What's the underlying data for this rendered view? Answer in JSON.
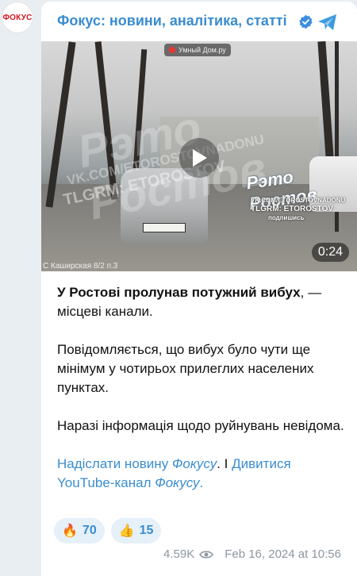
{
  "avatar": {
    "label": "ФОКУС"
  },
  "header": {
    "channel_name": "Фокус: новини, аналітика, статті",
    "verified_icon": "verified-badge-icon",
    "telegram_icon": "telegram-plane-icon"
  },
  "video": {
    "camera_tag": "Умный Дом.ру",
    "watermark_title": "Рэто Ростов",
    "watermark_vk": "VK.COM/ETOROSTOVNADONU",
    "watermark_tlgrm": "TLGRM: ETOROSTOV",
    "logo_title": "Рэто Ростов",
    "logo_vk": "VK.COM/ETOROSTOVNADONU",
    "logo_tlgrm": "TLGRM: ETOROSTOV",
    "logo_subscribe": "подпишись",
    "address": "С Каширская 8/2 п.3",
    "duration": "0:24"
  },
  "post": {
    "lead_bold": "У Ростові пролунав потужний вибух",
    "lead_rest": ", — місцеві канали.",
    "para2": "Повідомляється, що вибух було чути ще мінімум у чотирьох прилеглих населених пунктах.",
    "para3": "Наразі інформація щодо руйнувань невідома.",
    "link1_a": "Надіслати новину ",
    "link1_b": "Фокусу",
    "separator": ". I ",
    "link2_a": "Дивитися YouTube-канал ",
    "link2_b": "Фокусу",
    "link_end": "."
  },
  "reactions": [
    {
      "emoji": "🔥",
      "count": "70"
    },
    {
      "emoji": "👍",
      "count": "15"
    }
  ],
  "footer": {
    "views": "4.59K",
    "views_icon": "eye-icon",
    "date": "Feb 16, 2024 at 10:56"
  }
}
